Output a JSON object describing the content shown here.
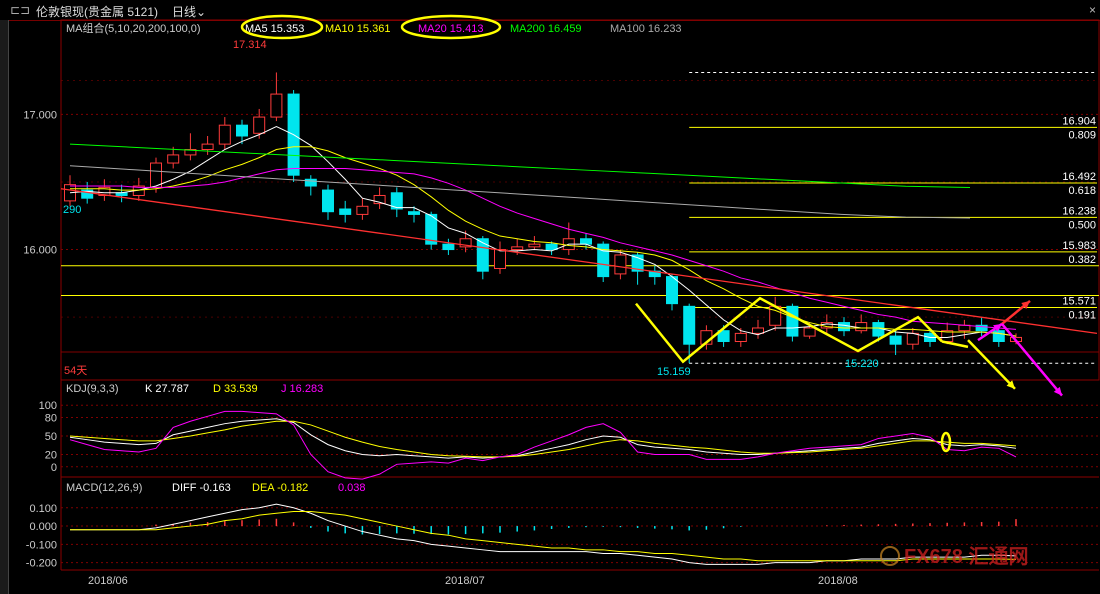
{
  "header": {
    "title": "伦敦银现(贵金属 5121)",
    "period": "日线",
    "close_symbol": "×"
  },
  "ma_legend": {
    "label": "MA组合(5,10,20,200,100,0)",
    "ma5": "MA5 15.353",
    "ma10": "MA10 15.361",
    "ma20": "MA20 15.413",
    "ma200": "MA200 16.459",
    "ma100": "MA100 16.233"
  },
  "colors": {
    "up": "#ff3b3b",
    "down": "#00e5ee",
    "ma5": "#ffffff",
    "ma10": "#ffff00",
    "ma20": "#ff00ff",
    "ma200": "#00ff00",
    "ma100": "#aaaaaa",
    "fib": "#ffff00",
    "grid": "#800000",
    "axis_text": "#cccccc",
    "annot_yellow": "#ffff00"
  },
  "chart_data": [
    {
      "type": "candlestick",
      "title": "伦敦银现 日线",
      "y_ticks": [
        "17.000",
        "16.000"
      ],
      "y_tick_values": [
        17.0,
        16.0
      ],
      "ylim": [
        15.05,
        17.55
      ],
      "x_ticks": [
        "2018/06",
        "2018/07",
        "2018/08"
      ],
      "annotations": {
        "high": "17.314",
        "left_value": "290",
        "low1": "15.159",
        "low2": "15.220",
        "days": "54天"
      },
      "candles": [
        [
          16.36,
          16.48,
          16.55,
          16.32
        ],
        [
          16.44,
          16.38,
          16.5,
          16.34
        ],
        [
          16.4,
          16.46,
          16.52,
          16.36
        ],
        [
          16.42,
          16.4,
          16.48,
          16.35
        ],
        [
          16.4,
          16.47,
          16.53,
          16.36
        ],
        [
          16.46,
          16.64,
          16.68,
          16.42
        ],
        [
          16.64,
          16.7,
          16.76,
          16.6
        ],
        [
          16.7,
          16.74,
          16.86,
          16.66
        ],
        [
          16.74,
          16.78,
          16.84,
          16.7
        ],
        [
          16.78,
          16.92,
          16.98,
          16.74
        ],
        [
          16.92,
          16.84,
          16.96,
          16.78
        ],
        [
          16.86,
          16.98,
          17.04,
          16.82
        ],
        [
          16.98,
          17.15,
          17.31,
          16.95
        ],
        [
          17.15,
          16.55,
          17.18,
          16.5
        ],
        [
          16.52,
          16.47,
          16.55,
          16.4
        ],
        [
          16.44,
          16.28,
          16.48,
          16.22
        ],
        [
          16.3,
          16.26,
          16.36,
          16.2
        ],
        [
          16.26,
          16.32,
          16.38,
          16.22
        ],
        [
          16.34,
          16.4,
          16.46,
          16.3
        ],
        [
          16.42,
          16.3,
          16.46,
          16.24
        ],
        [
          16.28,
          16.26,
          16.32,
          16.2
        ],
        [
          16.26,
          16.04,
          16.28,
          16.0
        ],
        [
          16.04,
          16.0,
          16.08,
          15.96
        ],
        [
          16.02,
          16.08,
          16.14,
          15.98
        ],
        [
          16.08,
          15.84,
          16.1,
          15.78
        ],
        [
          15.86,
          16.0,
          16.06,
          15.82
        ],
        [
          16.0,
          16.02,
          16.08,
          15.96
        ],
        [
          16.02,
          16.04,
          16.1,
          16.0
        ],
        [
          16.04,
          16.0,
          16.06,
          15.96
        ],
        [
          16.0,
          16.08,
          16.2,
          15.96
        ],
        [
          16.08,
          16.04,
          16.12,
          16.0
        ],
        [
          16.04,
          15.8,
          16.06,
          15.76
        ],
        [
          15.82,
          15.96,
          16.0,
          15.78
        ],
        [
          15.96,
          15.84,
          15.98,
          15.74
        ],
        [
          15.84,
          15.8,
          15.88,
          15.74
        ],
        [
          15.8,
          15.6,
          15.82,
          15.55
        ],
        [
          15.58,
          15.3,
          15.6,
          15.16
        ],
        [
          15.3,
          15.4,
          15.44,
          15.26
        ],
        [
          15.4,
          15.32,
          15.44,
          15.28
        ],
        [
          15.32,
          15.38,
          15.42,
          15.28
        ],
        [
          15.38,
          15.42,
          15.48,
          15.34
        ],
        [
          15.44,
          15.58,
          15.65,
          15.4
        ],
        [
          15.58,
          15.36,
          15.6,
          15.32
        ],
        [
          15.36,
          15.42,
          15.46,
          15.34
        ],
        [
          15.42,
          15.46,
          15.52,
          15.38
        ],
        [
          15.46,
          15.4,
          15.5,
          15.36
        ],
        [
          15.4,
          15.46,
          15.52,
          15.38
        ],
        [
          15.46,
          15.36,
          15.48,
          15.32
        ],
        [
          15.36,
          15.3,
          15.4,
          15.22
        ],
        [
          15.3,
          15.38,
          15.42,
          15.26
        ],
        [
          15.38,
          15.32,
          15.42,
          15.28
        ],
        [
          15.32,
          15.4,
          15.46,
          15.3
        ],
        [
          15.4,
          15.44,
          15.48,
          15.34
        ],
        [
          15.44,
          15.4,
          15.5,
          15.36
        ],
        [
          15.4,
          15.32,
          15.44,
          15.28
        ],
        [
          15.32,
          15.35,
          15.38,
          15.3
        ]
      ],
      "series": [
        {
          "name": "MA5",
          "values": [
            16.42,
            16.43,
            16.42,
            16.42,
            16.44,
            16.47,
            16.52,
            16.58,
            16.66,
            16.74,
            16.8,
            16.85,
            16.91,
            16.85,
            16.77,
            16.65,
            16.52,
            16.38,
            16.35,
            16.31,
            16.31,
            16.25,
            16.16,
            16.12,
            16.05,
            15.99,
            15.99,
            16.0,
            15.99,
            16.04,
            16.04,
            15.99,
            15.98,
            15.94,
            15.89,
            15.8,
            15.7,
            15.59,
            15.48,
            15.4,
            15.37,
            15.42,
            15.42,
            15.43,
            15.45,
            15.44,
            15.42,
            15.42,
            15.39,
            15.38,
            15.35,
            15.35,
            15.37,
            15.39,
            15.38,
            15.36
          ]
        },
        {
          "name": "MA10",
          "values": [
            16.45,
            16.45,
            16.45,
            16.44,
            16.44,
            16.45,
            16.47,
            16.5,
            16.54,
            16.59,
            16.63,
            16.68,
            16.74,
            16.76,
            16.76,
            16.73,
            16.68,
            16.64,
            16.6,
            16.55,
            16.48,
            16.39,
            16.29,
            16.21,
            16.15,
            16.1,
            16.08,
            16.06,
            16.05,
            16.03,
            16.02,
            16.0,
            15.99,
            15.98,
            15.96,
            15.92,
            15.85,
            15.77,
            15.71,
            15.64,
            15.58,
            15.55,
            15.5,
            15.46,
            15.43,
            15.42,
            15.42,
            15.42,
            15.41,
            15.41,
            15.4,
            15.39,
            15.39,
            15.39,
            15.38,
            15.36
          ]
        },
        {
          "name": "MA20",
          "values": [
            16.47,
            16.47,
            16.47,
            16.47,
            16.46,
            16.46,
            16.46,
            16.47,
            16.48,
            16.5,
            16.53,
            16.56,
            16.59,
            16.6,
            16.6,
            16.6,
            16.6,
            16.59,
            16.58,
            16.57,
            16.56,
            16.53,
            16.49,
            16.44,
            16.38,
            16.32,
            16.27,
            16.23,
            16.19,
            16.15,
            16.12,
            16.09,
            16.05,
            16.02,
            15.99,
            15.96,
            15.92,
            15.88,
            15.84,
            15.79,
            15.76,
            15.72,
            15.68,
            15.64,
            15.61,
            15.58,
            15.55,
            15.52,
            15.5,
            15.47,
            15.46,
            15.45,
            15.44,
            15.43,
            15.42,
            15.41
          ]
        },
        {
          "name": "MA200",
          "values": [
            16.78,
            16.756,
            16.732,
            16.708,
            16.684,
            16.66,
            16.636,
            16.612,
            16.588,
            16.564,
            16.54,
            16.516,
            16.492,
            16.468,
            16.459
          ]
        },
        {
          "name": "MA100",
          "values": [
            16.62,
            16.59,
            16.56,
            16.53,
            16.5,
            16.47,
            16.44,
            16.41,
            16.38,
            16.35,
            16.32,
            16.29,
            16.26,
            16.24,
            16.233
          ]
        }
      ],
      "fib_levels": [
        {
          "price": "16.904",
          "ratio": "0.809"
        },
        {
          "price": "16.492",
          "ratio": "0.618"
        },
        {
          "price": "16.238",
          "ratio": "0.500"
        },
        {
          "price": "15.983",
          "ratio": "0.382"
        },
        {
          "price": "15.571",
          "ratio": "0.191"
        }
      ],
      "fib_prices": [
        16.904,
        16.492,
        16.238,
        15.983,
        15.571
      ],
      "horizontal_lines": [
        17.31,
        15.88,
        15.66,
        15.159
      ],
      "trendline": {
        "from": 16.45,
        "to": 15.38
      },
      "zigzag": [
        15.6,
        15.17,
        15.64,
        15.25,
        15.5,
        15.32
      ],
      "arrows": {
        "up_target": 15.62,
        "down_target": 14.92
      }
    },
    {
      "type": "line",
      "title": "KDJ(9,3,3)",
      "label": "KDJ(9,3,3)",
      "k_label": "K 27.787",
      "d_label": "D 33.539",
      "j_label": "J 16.283",
      "y_ticks": [
        "100",
        "80",
        "50",
        "20",
        "0"
      ],
      "y_tick_values": [
        100,
        80,
        50,
        20,
        0
      ],
      "ylim": [
        -15,
        115
      ],
      "series": [
        {
          "name": "K",
          "values": [
            48,
            44,
            40,
            38,
            36,
            38,
            52,
            58,
            64,
            70,
            74,
            76,
            78,
            72,
            52,
            36,
            26,
            20,
            18,
            20,
            18,
            16,
            14,
            16,
            14,
            16,
            18,
            24,
            30,
            36,
            44,
            50,
            48,
            36,
            32,
            30,
            28,
            24,
            22,
            20,
            20,
            22,
            24,
            26,
            28,
            30,
            32,
            38,
            42,
            46,
            44,
            36,
            34,
            36,
            34,
            30
          ]
        },
        {
          "name": "D",
          "values": [
            50,
            48,
            46,
            44,
            42,
            42,
            46,
            50,
            55,
            60,
            66,
            70,
            74,
            74,
            68,
            58,
            48,
            40,
            33,
            28,
            24,
            20,
            18,
            17,
            16,
            16,
            17,
            20,
            24,
            28,
            34,
            40,
            44,
            42,
            38,
            35,
            32,
            30,
            27,
            24,
            22,
            22,
            23,
            24,
            26,
            28,
            30,
            34,
            38,
            42,
            42,
            40,
            38,
            38,
            36,
            34
          ]
        },
        {
          "name": "J",
          "values": [
            44,
            36,
            28,
            26,
            24,
            30,
            64,
            74,
            82,
            90,
            90,
            88,
            86,
            68,
            20,
            -8,
            -18,
            -20,
            -12,
            4,
            6,
            8,
            6,
            14,
            10,
            16,
            20,
            32,
            42,
            52,
            64,
            70,
            56,
            24,
            20,
            20,
            20,
            12,
            12,
            12,
            16,
            22,
            26,
            30,
            32,
            34,
            36,
            46,
            50,
            54,
            48,
            28,
            26,
            32,
            30,
            16
          ]
        }
      ]
    },
    {
      "type": "bar",
      "title": "MACD(12,26,9)",
      "label": "MACD(12,26,9)",
      "diff_label": "DIFF -0.163",
      "dea_label": "DEA -0.182",
      "macd_label": "0.038",
      "y_ticks": [
        "0.100",
        "0.000",
        "-0.100",
        "-0.200"
      ],
      "y_tick_values": [
        0.1,
        0.0,
        -0.1,
        -0.2
      ],
      "ylim": [
        -0.235,
        0.17
      ],
      "histogram": [
        0,
        0,
        0,
        0,
        0,
        0.008,
        0.012,
        0.018,
        0.022,
        0.03,
        0.032,
        0.036,
        0.04,
        0.02,
        -0.01,
        -0.03,
        -0.04,
        -0.046,
        -0.044,
        -0.04,
        -0.042,
        -0.044,
        -0.046,
        -0.044,
        -0.04,
        -0.036,
        -0.03,
        -0.024,
        -0.016,
        -0.01,
        -0.006,
        -0.004,
        -0.006,
        -0.01,
        -0.014,
        -0.018,
        -0.024,
        -0.02,
        -0.012,
        -0.004,
        0,
        0,
        0,
        0,
        0.004,
        0.006,
        0.008,
        0.01,
        0.012,
        0.014,
        0.016,
        0.018,
        0.02,
        0.022,
        0.024,
        0.038
      ],
      "series": [
        {
          "name": "DIFF",
          "values": [
            -0.02,
            -0.02,
            -0.02,
            -0.02,
            -0.02,
            -0.01,
            0.01,
            0.03,
            0.05,
            0.07,
            0.09,
            0.1,
            0.12,
            0.1,
            0.07,
            0.03,
            0.0,
            -0.03,
            -0.05,
            -0.07,
            -0.08,
            -0.1,
            -0.11,
            -0.12,
            -0.13,
            -0.14,
            -0.14,
            -0.14,
            -0.14,
            -0.14,
            -0.14,
            -0.15,
            -0.15,
            -0.16,
            -0.17,
            -0.18,
            -0.2,
            -0.21,
            -0.21,
            -0.21,
            -0.21,
            -0.2,
            -0.2,
            -0.2,
            -0.19,
            -0.19,
            -0.18,
            -0.18,
            -0.18,
            -0.17,
            -0.17,
            -0.17,
            -0.17,
            -0.16,
            -0.16,
            -0.163
          ]
        },
        {
          "name": "DEA",
          "values": [
            -0.02,
            -0.02,
            -0.02,
            -0.02,
            -0.02,
            -0.02,
            -0.01,
            0.0,
            0.01,
            0.03,
            0.04,
            0.06,
            0.07,
            0.08,
            0.08,
            0.07,
            0.06,
            0.04,
            0.02,
            0.0,
            -0.02,
            -0.04,
            -0.05,
            -0.07,
            -0.08,
            -0.09,
            -0.1,
            -0.11,
            -0.12,
            -0.12,
            -0.13,
            -0.13,
            -0.14,
            -0.14,
            -0.15,
            -0.15,
            -0.16,
            -0.17,
            -0.18,
            -0.18,
            -0.19,
            -0.19,
            -0.19,
            -0.19,
            -0.19,
            -0.19,
            -0.19,
            -0.19,
            -0.19,
            -0.18,
            -0.18,
            -0.18,
            -0.18,
            -0.18,
            -0.18,
            -0.182
          ]
        }
      ]
    }
  ],
  "watermark": "FX678 汇通网"
}
